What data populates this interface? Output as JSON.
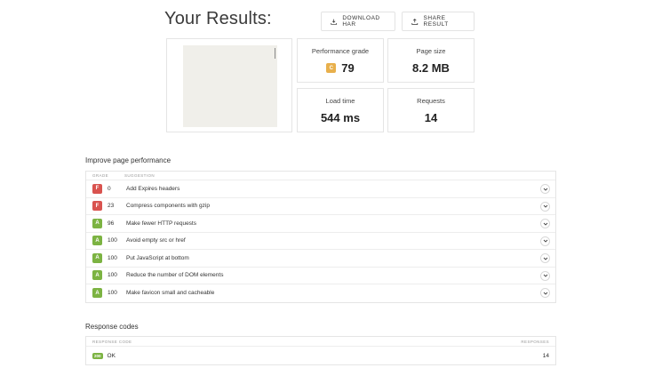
{
  "header": {
    "title": "Your Results:"
  },
  "toolbar": {
    "download_label": "DOWNLOAD HAR",
    "share_label": "SHARE RESULT"
  },
  "stats": {
    "performance": {
      "label": "Performance grade",
      "grade": "C",
      "value": "79"
    },
    "page_size": {
      "label": "Page size",
      "value": "8.2 MB"
    },
    "load_time": {
      "label": "Load time",
      "value": "544 ms"
    },
    "requests": {
      "label": "Requests",
      "value": "14"
    }
  },
  "improve": {
    "title": "Improve page performance",
    "columns": [
      "GRADE",
      "SUGGESTION"
    ],
    "rows": [
      {
        "grade": "F",
        "score": "0",
        "suggestion": "Add Expires headers"
      },
      {
        "grade": "F",
        "score": "23",
        "suggestion": "Compress components with gzip"
      },
      {
        "grade": "A",
        "score": "96",
        "suggestion": "Make fewer HTTP requests"
      },
      {
        "grade": "A",
        "score": "100",
        "suggestion": "Avoid empty src or href"
      },
      {
        "grade": "A",
        "score": "100",
        "suggestion": "Put JavaScript at bottom"
      },
      {
        "grade": "A",
        "score": "100",
        "suggestion": "Reduce the number of DOM elements"
      },
      {
        "grade": "A",
        "score": "100",
        "suggestion": "Make favicon small and cacheable"
      }
    ]
  },
  "response": {
    "title": "Response codes",
    "columns": [
      "RESPONSE CODE",
      "RESPONSES"
    ],
    "rows": [
      {
        "code": "200",
        "text": "OK",
        "count": "14"
      }
    ]
  },
  "colors": {
    "grade_F": "#d9534f",
    "grade_A": "#7cb342",
    "grade_C": "#e8b04c"
  }
}
